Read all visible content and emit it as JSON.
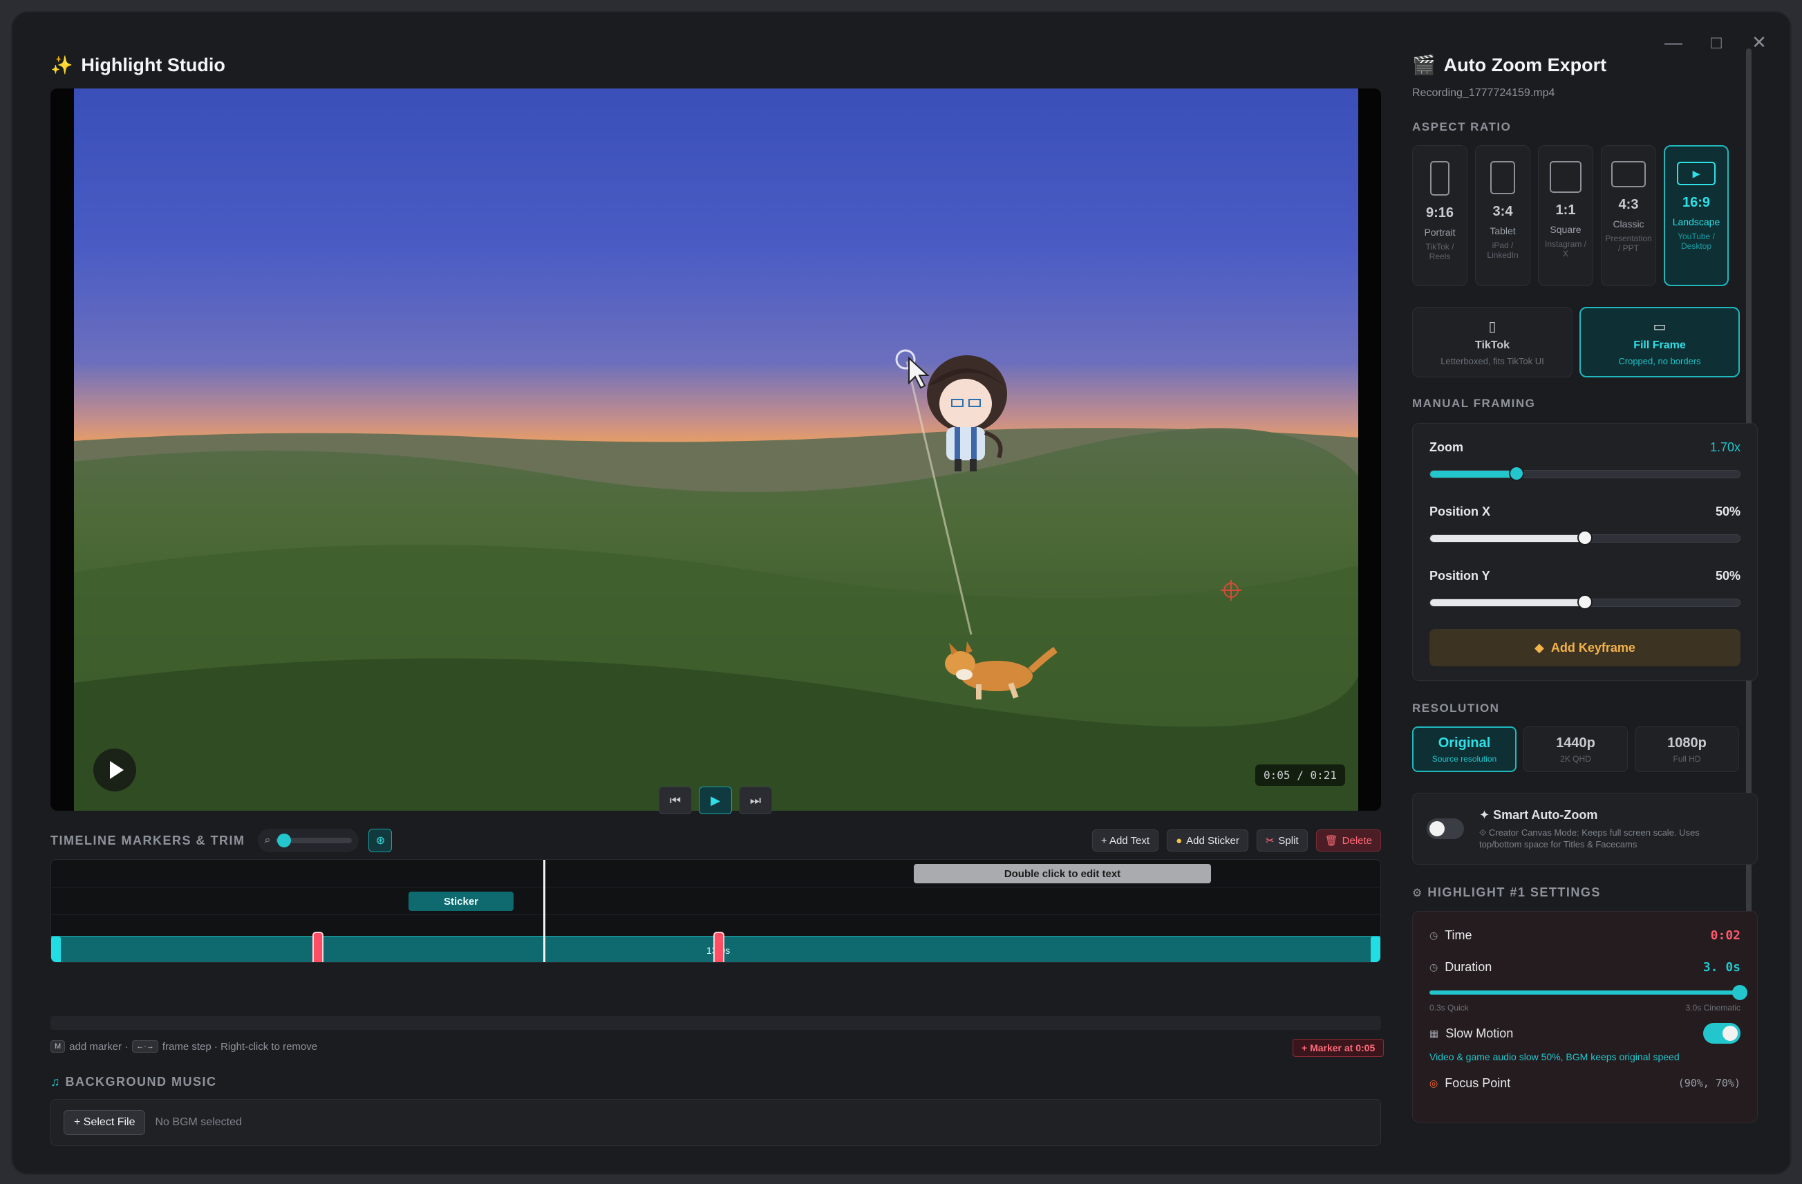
{
  "window": {
    "controls": [
      "—",
      "□",
      "✕"
    ]
  },
  "app": {
    "title": "Highlight Studio",
    "icon": "sparkles-icon"
  },
  "player": {
    "timecode": "0:05 / 0:21"
  },
  "timeline": {
    "title": "TIMELINE MARKERS & TRIM",
    "actions": {
      "add_text": "+ Add Text",
      "add_sticker": "Add Sticker",
      "split": "Split",
      "delete": "Delete"
    },
    "text_clip": "Double click to edit text",
    "sticker_clip": "Sticker",
    "clip_label": "13.0s",
    "hint": {
      "add": "add marker ·",
      "step": "frame step · Right-click to remove"
    },
    "marker_badge": "+ Marker at 0:05"
  },
  "bgm": {
    "title": "BACKGROUND MUSIC",
    "select": "+ Select File",
    "status": "No BGM selected"
  },
  "export": {
    "title": "Auto Zoom Export",
    "file": "Recording_1777724159.mp4",
    "aspect_title": "ASPECT RATIO",
    "ratios": [
      {
        "value": "9:16",
        "name": "Portrait",
        "desc": "TikTok / Reels"
      },
      {
        "value": "3:4",
        "name": "Tablet",
        "desc": "iPad / LinkedIn"
      },
      {
        "value": "1:1",
        "name": "Square",
        "desc": "Instagram / X"
      },
      {
        "value": "4:3",
        "name": "Classic",
        "desc": "Presentation / PPT"
      },
      {
        "value": "16:9",
        "name": "Landscape",
        "desc": "YouTube / Desktop"
      }
    ],
    "fit": [
      {
        "title": "TikTok",
        "desc": "Letterboxed, fits TikTok UI"
      },
      {
        "title": "Fill Frame",
        "desc": "Cropped, no borders"
      }
    ],
    "framing_title": "MANUAL FRAMING",
    "zoom": {
      "label": "Zoom",
      "value": "1.70x",
      "level": 0.28
    },
    "pos_x": {
      "label": "Position X",
      "value": "50%",
      "level": 0.5
    },
    "pos_y": {
      "label": "Position Y",
      "value": "50%",
      "level": 0.5
    },
    "keyframe": "Add Keyframe",
    "resolution_title": "RESOLUTION",
    "resolutions": [
      {
        "title": "Original",
        "desc": "Source resolution"
      },
      {
        "title": "1440p",
        "desc": "2K QHD"
      },
      {
        "title": "1080p",
        "desc": "Full HD"
      }
    ],
    "smart": {
      "title": "✦ Smart Auto-Zoom",
      "desc": "⟐ Creator Canvas Mode: Keeps full screen scale. Uses top/bottom space for Titles & Facecams"
    },
    "highlight_title": "HIGHLIGHT #1 SETTINGS",
    "highlight": {
      "time_label": "Time",
      "time_value": "0:02",
      "duration_label": "Duration",
      "duration_value": "3. 0s",
      "scale_min": "0.3s Quick",
      "scale_max": "3.0s Cinematic",
      "slow_label": "Slow Motion",
      "slow_desc": "Video & game audio slow 50%, BGM keeps original speed",
      "focus_label": "Focus Point",
      "focus_value": "(90%, 70%)"
    }
  },
  "colors": {
    "accent": "#22c6cc",
    "marker": "#ff4d63",
    "keyframe": "#f3b34a"
  }
}
